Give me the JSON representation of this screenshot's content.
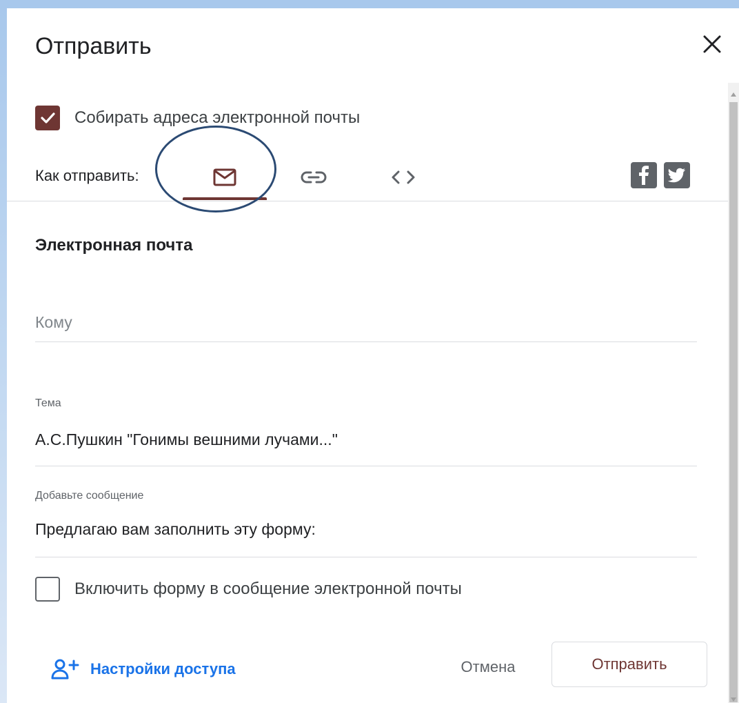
{
  "dialog": {
    "title": "Отправить"
  },
  "collect_emails": {
    "label": "Собирать адреса электронной почты",
    "checked": true
  },
  "send_via": {
    "label": "Как отправить:",
    "tabs": [
      {
        "name": "email",
        "icon": "mail-icon",
        "active": true
      },
      {
        "name": "link",
        "icon": "link-icon",
        "active": false
      },
      {
        "name": "embed",
        "icon": "code-icon",
        "active": false
      }
    ],
    "social": [
      "facebook-icon",
      "twitter-icon"
    ]
  },
  "email_section": {
    "title": "Электронная почта",
    "to": {
      "placeholder": "Кому",
      "value": ""
    },
    "subject": {
      "label": "Тема",
      "value": "А.С.Пушкин \"Гонимы вешними лучами...\""
    },
    "message": {
      "label": "Добавьте сообщение",
      "value": "Предлагаю вам заполнить эту форму:"
    }
  },
  "include_form": {
    "label": "Включить форму в сообщение электронной почты",
    "checked": false
  },
  "footer": {
    "access_label": "Настройки доступа",
    "cancel_label": "Отмена",
    "send_label": "Отправить"
  },
  "colors": {
    "accent": "#6e3633",
    "link": "#1a73e8",
    "annotation": "#2b4a73"
  }
}
